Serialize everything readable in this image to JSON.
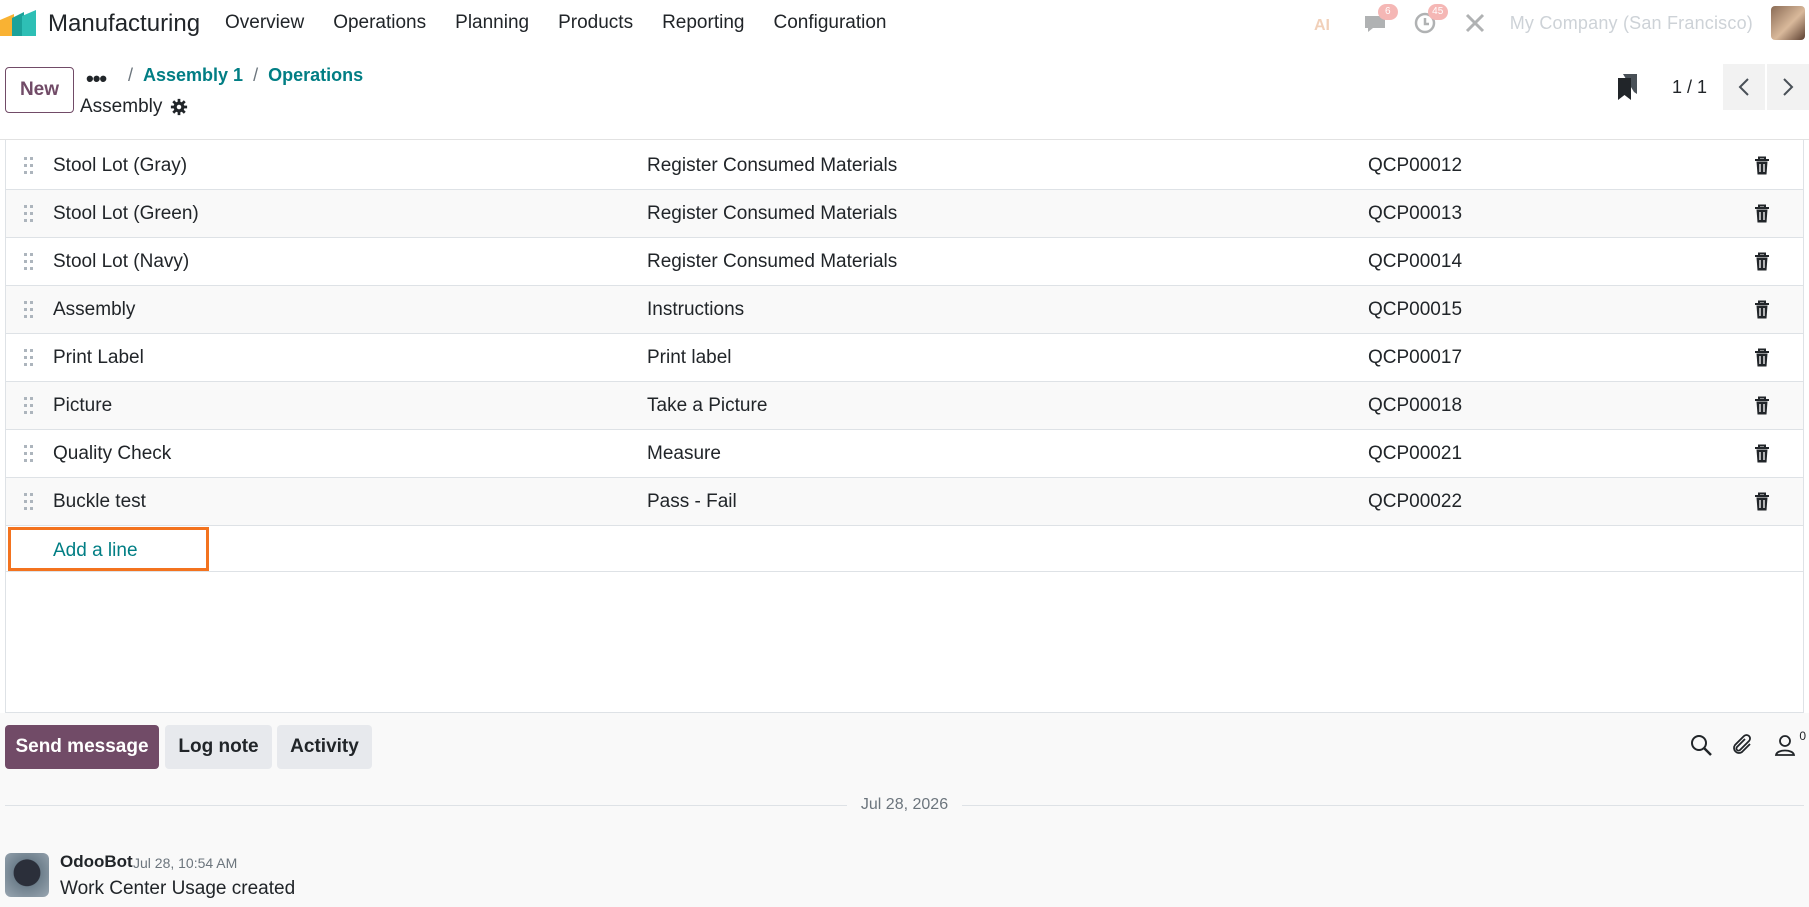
{
  "navbar": {
    "app_name": "Manufacturing",
    "menu": [
      "Overview",
      "Operations",
      "Planning",
      "Products",
      "Reporting",
      "Configuration"
    ],
    "badges": {
      "messages": "6",
      "activities": "45"
    },
    "company": "My Company (San Francisco)"
  },
  "control_panel": {
    "new_label": "New",
    "more_label": "•••",
    "breadcrumbs": [
      "Assembly 1",
      "Operations"
    ],
    "record_title": "Assembly",
    "pager_value": "1 / 1"
  },
  "rows": [
    {
      "title": "Stool Lot (Gray)",
      "type": "Register Consumed Materials",
      "ref": "QCP00012"
    },
    {
      "title": "Stool Lot (Green)",
      "type": "Register Consumed Materials",
      "ref": "QCP00013"
    },
    {
      "title": "Stool Lot (Navy)",
      "type": "Register Consumed Materials",
      "ref": "QCP00014"
    },
    {
      "title": "Assembly",
      "type": "Instructions",
      "ref": "QCP00015"
    },
    {
      "title": "Print Label",
      "type": "Print label",
      "ref": "QCP00017"
    },
    {
      "title": "Picture",
      "type": "Take a Picture",
      "ref": "QCP00018"
    },
    {
      "title": "Quality Check",
      "type": "Measure",
      "ref": "QCP00021"
    },
    {
      "title": "Buckle test",
      "type": "Pass - Fail",
      "ref": "QCP00022"
    }
  ],
  "add_line_label": "Add a line",
  "chatter": {
    "send_label": "Send message",
    "log_label": "Log note",
    "activity_label": "Activity",
    "followers_count": "0",
    "date_separator": "Jul 28, 2026",
    "message": {
      "author": "OdooBot",
      "date": "Jul 28, 10:54 AM",
      "body": "Work Center Usage created"
    }
  },
  "colors": {
    "brand": "#714b67",
    "link": "#017e84",
    "highlight": "#f3731f"
  }
}
